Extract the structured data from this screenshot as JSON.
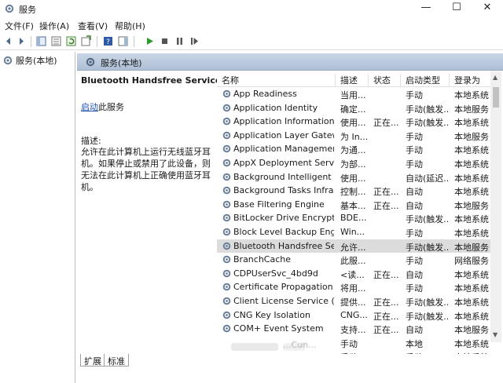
{
  "window": {
    "title": "服务",
    "minimize_glyph": "—",
    "maximize_glyph": "☐",
    "close_glyph": "✕"
  },
  "menu": [
    "文件(F)",
    "操作(A)",
    "查看(V)",
    "帮助(H)"
  ],
  "tree": {
    "root_label": "服务(本地)"
  },
  "pane_header": {
    "label": "服务(本地)"
  },
  "selected_service": {
    "title": "Bluetooth Handsfree Service",
    "start_link": "启动",
    "start_suffix": "此服务",
    "desc_label": "描述:",
    "desc_text": "允许在此计算机上运行无线蓝牙耳机。如果停止或禁用了此设备，则无法在此计算机上正确使用蓝牙耳机。"
  },
  "columns": [
    "名称",
    "描述",
    "状态",
    "启动类型",
    "登录为"
  ],
  "services": [
    {
      "name": "App Readiness",
      "desc": "当用...",
      "status": "",
      "startup": "手动",
      "logon": "本地系统"
    },
    {
      "name": "Application Identity",
      "desc": "确定...",
      "status": "",
      "startup": "手动(触发...",
      "logon": "本地服务"
    },
    {
      "name": "Application Information",
      "desc": "使用...",
      "status": "正在...",
      "startup": "手动(触发...",
      "logon": "本地系统"
    },
    {
      "name": "Application Layer Gatewa...",
      "desc": "为 In...",
      "status": "",
      "startup": "手动",
      "logon": "本地服务"
    },
    {
      "name": "Application Management",
      "desc": "为通...",
      "status": "",
      "startup": "手动",
      "logon": "本地系统"
    },
    {
      "name": "AppX Deployment Servic...",
      "desc": "为部...",
      "status": "",
      "startup": "手动",
      "logon": "本地系统"
    },
    {
      "name": "Background Intelligent T...",
      "desc": "使用...",
      "status": "",
      "startup": "自动(延迟...",
      "logon": "本地系统"
    },
    {
      "name": "Background Tasks Infras...",
      "desc": "控制...",
      "status": "正在...",
      "startup": "自动",
      "logon": "本地系统"
    },
    {
      "name": "Base Filtering Engine",
      "desc": "基本...",
      "status": "正在...",
      "startup": "自动",
      "logon": "本地服务"
    },
    {
      "name": "BitLocker Drive Encryptio...",
      "desc": "BDE...",
      "status": "",
      "startup": "手动(触发...",
      "logon": "本地系统"
    },
    {
      "name": "Block Level Backup Engi...",
      "desc": "Win...",
      "status": "",
      "startup": "手动",
      "logon": "本地系统"
    },
    {
      "name": "Bluetooth Handsfree Ser...",
      "desc": "允许...",
      "status": "",
      "startup": "手动(触发...",
      "logon": "本地服务"
    },
    {
      "name": "BranchCache",
      "desc": "此服...",
      "status": "",
      "startup": "手动",
      "logon": "网络服务"
    },
    {
      "name": "CDPUserSvc_4bd9d",
      "desc": "<读...",
      "status": "正在...",
      "startup": "自动",
      "logon": "本地系统"
    },
    {
      "name": "Certificate Propagation",
      "desc": "将用...",
      "status": "",
      "startup": "手动",
      "logon": "本地系统"
    },
    {
      "name": "Client License Service (Cli...",
      "desc": "提供...",
      "status": "正在...",
      "startup": "手动(触发...",
      "logon": "本地系统"
    },
    {
      "name": "CNG Key Isolation",
      "desc": "CNG...",
      "status": "正在...",
      "startup": "手动(触发...",
      "logon": "本地系统"
    },
    {
      "name": "COM+ Event System",
      "desc": "支持...",
      "status": "正在...",
      "startup": "自动",
      "logon": "本地服务"
    },
    {
      "name": "",
      "desc": "手动",
      "status": "",
      "startup": "本地",
      "logon": "本地系统"
    },
    {
      "name": "",
      "desc": "手动",
      "status": "",
      "startup": "手动",
      "logon": "本地系统"
    },
    {
      "name": "",
      "desc": "手动",
      "status": "",
      "startup": "手动",
      "logon": "本地服务"
    }
  ],
  "blurred_partial_text": [
    "...Cun...",
    "...OM..."
  ],
  "tabs": [
    "扩展",
    "标准"
  ]
}
